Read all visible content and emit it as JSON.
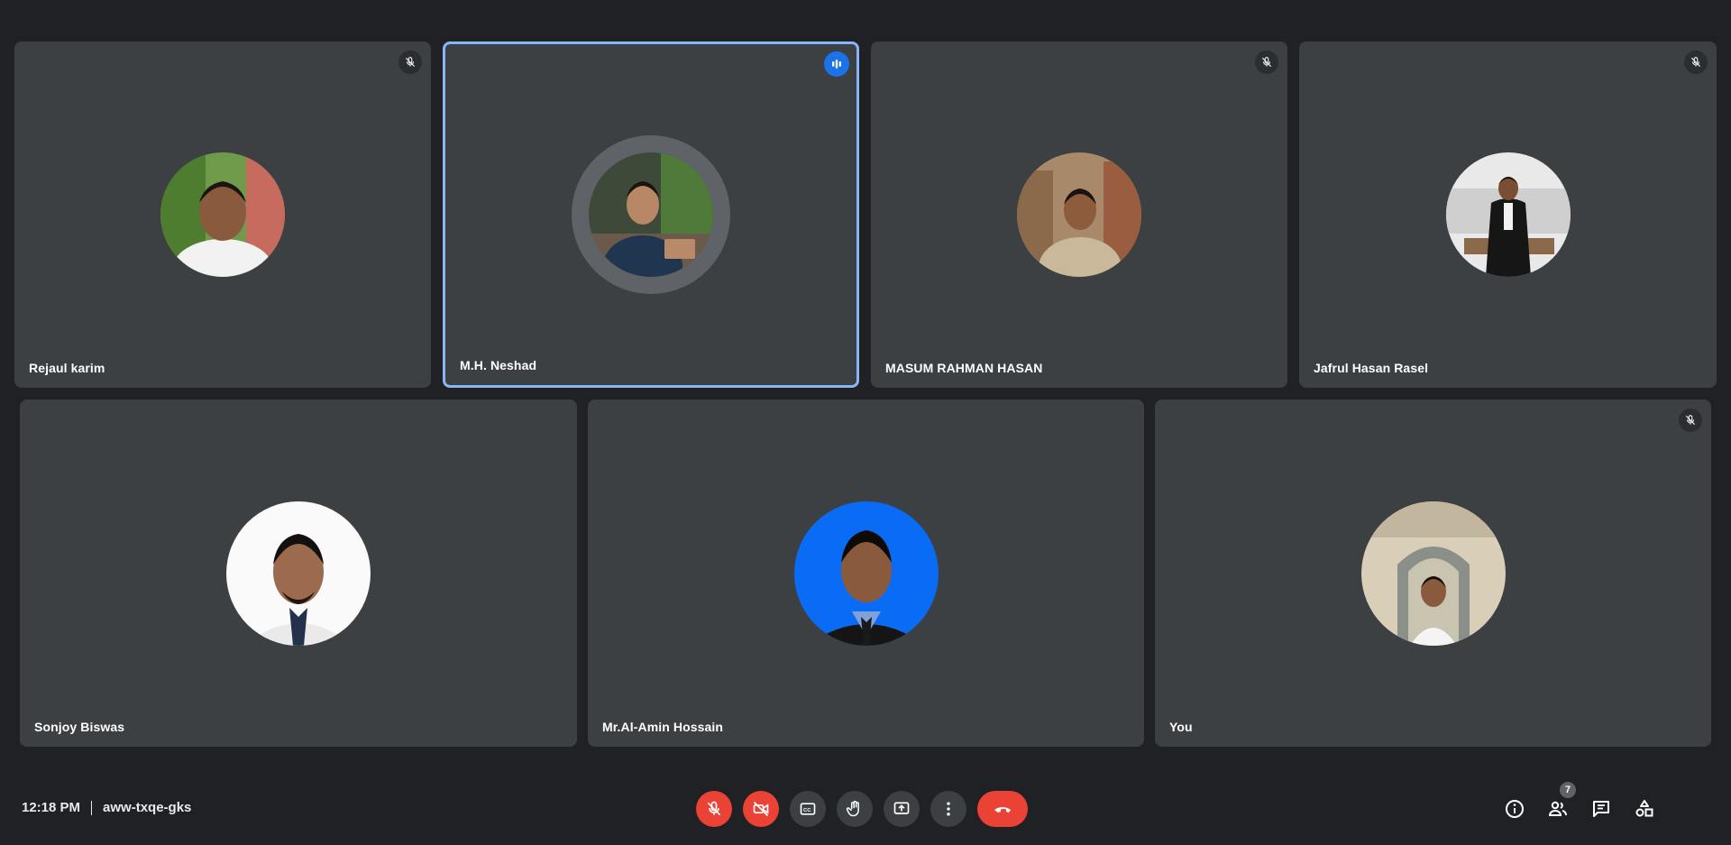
{
  "participants": [
    {
      "name": "Rejaul karim",
      "muted": true,
      "speaking": false
    },
    {
      "name": "M.H. Neshad",
      "muted": false,
      "speaking": true
    },
    {
      "name": "MASUM RAHMAN HASAN",
      "muted": true,
      "speaking": false
    },
    {
      "name": "Jafrul Hasan Rasel",
      "muted": true,
      "speaking": false
    },
    {
      "name": "Sonjoy Biswas",
      "muted": false,
      "speaking": false
    },
    {
      "name": "Mr.Al-Amin Hossain",
      "muted": false,
      "speaking": false
    },
    {
      "name": "You",
      "muted": true,
      "speaking": false
    }
  ],
  "bottom_bar": {
    "time": "12:18 PM",
    "meeting_code": "aww-txqe-gks",
    "people_count": "7",
    "controls": [
      {
        "icon": "mic-off-icon",
        "state": "off"
      },
      {
        "icon": "camera-off-icon",
        "state": "off"
      },
      {
        "icon": "captions-icon",
        "state": "normal"
      },
      {
        "icon": "raise-hand-icon",
        "state": "normal"
      },
      {
        "icon": "present-screen-icon",
        "state": "normal"
      },
      {
        "icon": "more-options-icon",
        "state": "normal"
      },
      {
        "icon": "end-call-icon",
        "state": "leave"
      }
    ],
    "right_icons": [
      "info-icon",
      "people-icon",
      "chat-icon",
      "activities-icon"
    ]
  },
  "colors": {
    "background": "#202124",
    "tile": "#3c4043",
    "active_border": "#8ab4f8",
    "danger": "#ea4335",
    "speaking": "#1a73e8"
  }
}
